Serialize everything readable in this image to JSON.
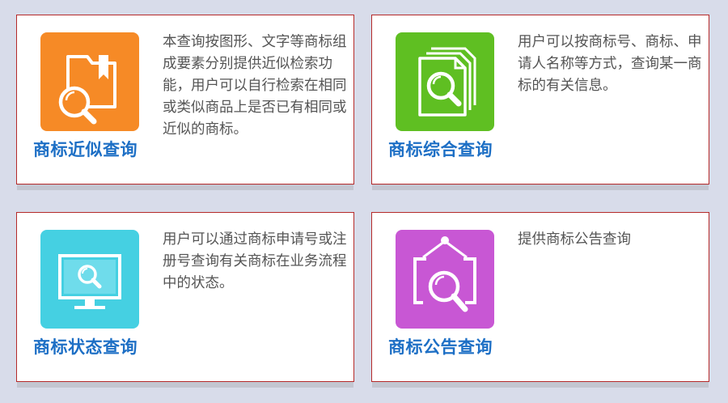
{
  "cards": [
    {
      "title": "商标近似查询",
      "description": "本查询按图形、文字等商标组成要素分别提供近似检索功能，用户可以自行检索在相同或类似商品上是否已有相同或近似的商标。",
      "icon": "folder-search-icon",
      "color": "#f68a26"
    },
    {
      "title": "商标综合查询",
      "description": "用户可以按商标号、商标、申请人名称等方式，查询某一商标的有关信息。",
      "icon": "documents-search-icon",
      "color": "#5fbf22"
    },
    {
      "title": "商标状态查询",
      "description": "用户可以通过商标申请号或注册号查询有关商标在业务流程中的状态。",
      "icon": "monitor-search-icon",
      "color": "#45d0e2"
    },
    {
      "title": "商标公告查询",
      "description": "提供商标公告查询",
      "icon": "notice-board-search-icon",
      "color": "#c857d4"
    }
  ]
}
